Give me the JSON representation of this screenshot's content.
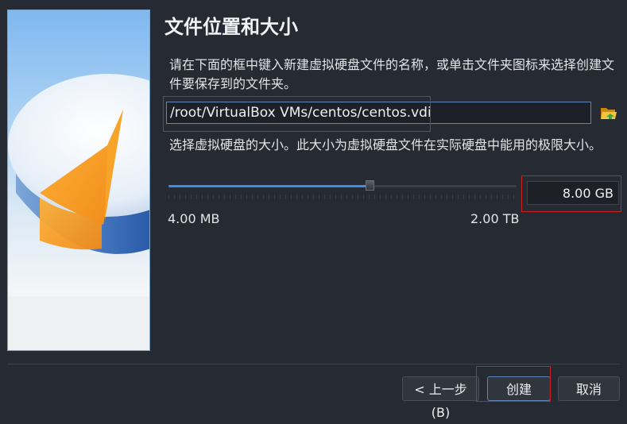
{
  "header": {
    "title": "文件位置和大小"
  },
  "location": {
    "description": "请在下面的框中键入新建虚拟硬盘文件的名称，或单击文件夹图标来选择创建文件要保存到的文件夹。",
    "path_value": "/root/VirtualBox VMs/centos/centos.vdi",
    "folder_icon": "folder-open-icon"
  },
  "size": {
    "description": "选择虚拟硬盘的大小。此大小为虚拟硬盘文件在实际硬盘中能用的极限大小。",
    "value": "8.00 GB",
    "slider_fraction": 0.58,
    "min_label": "4.00 MB",
    "max_label": "2.00 TB"
  },
  "buttons": {
    "back_label": "< 上一步(B)",
    "create_label": "创建",
    "cancel_label": "取消"
  },
  "colors": {
    "accent": "#3d8ee8",
    "annotation": "#cc2222"
  }
}
